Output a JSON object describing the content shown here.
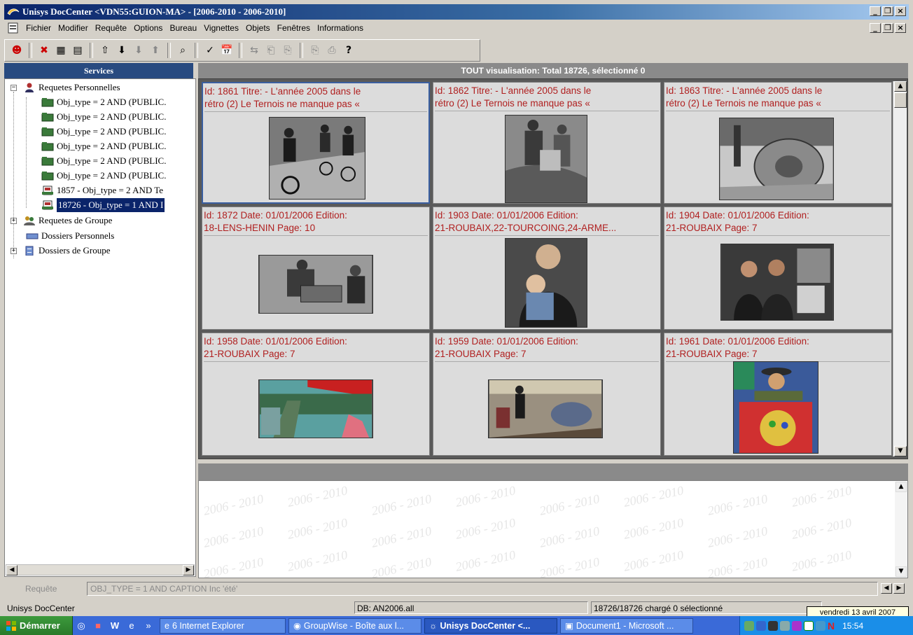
{
  "window": {
    "title": "Unisys DocCenter <VDN55:GUION-MA> - [2006-2010 - 2006-2010]"
  },
  "menu": [
    "Fichier",
    "Modifier",
    "Requête",
    "Options",
    "Bureau",
    "Vignettes",
    "Objets",
    "Fenêtres",
    "Informations"
  ],
  "left_panel": {
    "title": "Services",
    "tree": [
      {
        "label": "Requetes Personnelles",
        "type": "root"
      },
      {
        "label": "Obj_type = 2 AND (PUBLIC.",
        "type": "query"
      },
      {
        "label": "Obj_type = 2 AND (PUBLIC.",
        "type": "query"
      },
      {
        "label": "Obj_type = 2 AND (PUBLIC.",
        "type": "query"
      },
      {
        "label": "Obj_type = 2 AND (PUBLIC.",
        "type": "query"
      },
      {
        "label": "Obj_type = 2 AND (PUBLIC.",
        "type": "query"
      },
      {
        "label": "Obj_type = 2 AND (PUBLIC.",
        "type": "query"
      },
      {
        "label": "1857 - Obj_type = 2 AND Te",
        "type": "result"
      },
      {
        "label": "18726 - Obj_type = 1 AND I",
        "type": "result-selected"
      },
      {
        "label": "Requetes de Groupe",
        "type": "root"
      },
      {
        "label": "Dossiers Personnels",
        "type": "root"
      },
      {
        "label": "Dossiers de Groupe",
        "type": "root"
      }
    ]
  },
  "results": {
    "header": "TOUT visualisation: Total 18726, sélectionné 0",
    "cells": [
      {
        "l1": "Id: 1861     Titre: - L'année 2005 dans le",
        "l2": "rétro (2)  Le Ternois ne manque pas «"
      },
      {
        "l1": "Id: 1862     Titre: - L'année 2005 dans le",
        "l2": "rétro (2)  Le Ternois ne manque pas «"
      },
      {
        "l1": "Id: 1863     Titre: - L'année 2005 dans le",
        "l2": "rétro (2)  Le Ternois ne manque pas «"
      },
      {
        "l1": "Id: 1872     Date: 01/01/2006         Edition:",
        "l2": "18-LENS-HENIN         Page: 10"
      },
      {
        "l1": "Id: 1903     Date: 01/01/2006         Edition:",
        "l2": "21-ROUBAIX,22-TOURCOING,24-ARME..."
      },
      {
        "l1": "Id: 1904     Date: 01/01/2006         Edition:",
        "l2": "21-ROUBAIX                 Page: 7"
      },
      {
        "l1": "Id: 1958     Date: 01/01/2006         Edition:",
        "l2": "21-ROUBAIX           Page: 7"
      },
      {
        "l1": "Id: 1959     Date: 01/01/2006         Edition:",
        "l2": "21-ROUBAIX                 Page: 7"
      },
      {
        "l1": "Id: 1961     Date: 01/01/2006         Edition:",
        "l2": "21-ROUBAIX                 Page: 7"
      }
    ]
  },
  "detail": {
    "watermark": "2006 - 2010"
  },
  "query_bar": {
    "label": "Requête",
    "value": "OBJ_TYPE = 1 AND CAPTION Inc 'été'"
  },
  "status": {
    "app": "Unisys DocCenter",
    "db": "DB: AN2006.all",
    "counts": "18726/18726 chargé 0 sélectionné"
  },
  "tooltip": "vendredi 13 avril 2007",
  "taskbar": {
    "start": "Démarrer",
    "tasks": [
      {
        "label": "6 Internet Explorer"
      },
      {
        "label": "GroupWise - Boîte aux l..."
      },
      {
        "label": "Unisys DocCenter <..."
      },
      {
        "label": "Document1 - Microsoft ..."
      }
    ],
    "clock": "15:54"
  }
}
